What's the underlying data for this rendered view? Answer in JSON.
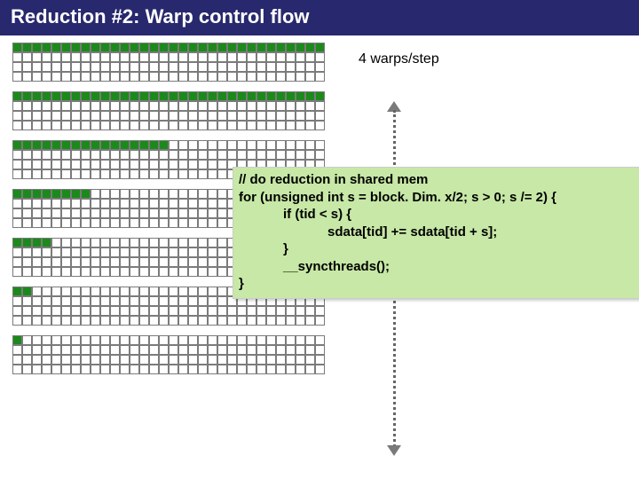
{
  "title": "Reduction #2: Warp control flow",
  "right_label": "4 warps/step",
  "cols": 32,
  "rows_per_block": 4,
  "blocks_active": [
    32,
    32,
    16,
    8,
    4,
    2,
    1
  ],
  "code": {
    "l0": "// do reduction in shared mem",
    "l1": "for (unsigned int s = block. Dim. x/2; s > 0; s /= 2) {",
    "l2": "if (tid < s) {",
    "l3": "sdata[tid] += sdata[tid + s];",
    "l4": "}",
    "l5": "__syncthreads();",
    "l6": "}"
  }
}
